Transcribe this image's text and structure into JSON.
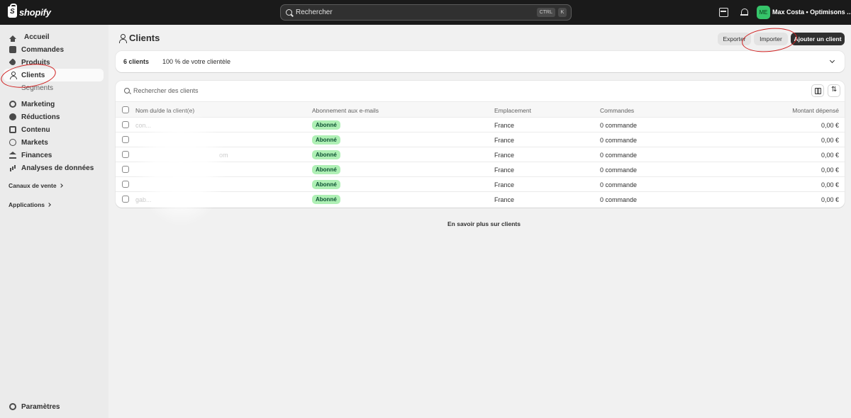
{
  "topbar": {
    "logo_text": "shopify",
    "search_placeholder": "Rechercher",
    "shortcut_ctrl": "CTRL",
    "shortcut_k": "K",
    "avatar_initials": "ME",
    "store_name": "Max Costa • Optimisons ..."
  },
  "sidebar": {
    "items": [
      {
        "label": "Accueil",
        "icon": "home-icon"
      },
      {
        "label": "Commandes",
        "icon": "inbox-icon"
      },
      {
        "label": "Produits",
        "icon": "tag-icon"
      },
      {
        "label": "Clients",
        "icon": "person-icon",
        "active": true
      },
      {
        "label": "Segments",
        "sub": true
      },
      {
        "label": "Marketing",
        "icon": "target-icon"
      },
      {
        "label": "Réductions",
        "icon": "discount-icon"
      },
      {
        "label": "Contenu",
        "icon": "content-icon"
      },
      {
        "label": "Markets",
        "icon": "globe-icon"
      },
      {
        "label": "Finances",
        "icon": "bank-icon"
      },
      {
        "label": "Analyses de données",
        "icon": "chart-icon"
      }
    ],
    "sales_channels": "Canaux de vente",
    "applications": "Applications",
    "settings": "Paramètres"
  },
  "page": {
    "title": "Clients",
    "export_label": "Exporter",
    "import_label": "Importer",
    "add_label": "Ajouter un client"
  },
  "stats": {
    "count": "6 clients",
    "percent": "100 % de votre clientèle"
  },
  "table": {
    "search_placeholder": "Rechercher des clients",
    "headers": {
      "name": "Nom du/de la client(e)",
      "subscription": "Abonnement aux e-mails",
      "location": "Emplacement",
      "orders": "Commandes",
      "spent": "Montant dépensé"
    },
    "rows": [
      {
        "name": "con...",
        "subscription": "Abonné",
        "location": "France",
        "orders": "0 commande",
        "spent": "0,00 €"
      },
      {
        "name": "",
        "subscription": "Abonné",
        "location": "France",
        "orders": "0 commande",
        "spent": "0,00 €"
      },
      {
        "name": "om",
        "subscription": "Abonné",
        "location": "France",
        "orders": "0 commande",
        "spent": "0,00 €"
      },
      {
        "name": "",
        "subscription": "Abonné",
        "location": "France",
        "orders": "0 commande",
        "spent": "0,00 €"
      },
      {
        "name": "",
        "subscription": "Abonné",
        "location": "France",
        "orders": "0 commande",
        "spent": "0,00 €"
      },
      {
        "name": "gab...",
        "subscription": "Abonné",
        "location": "France",
        "orders": "0 commande",
        "spent": "0,00 €"
      }
    ]
  },
  "footer": {
    "learn_more": "En savoir plus sur clients"
  },
  "colors": {
    "topbar": "#1a1a1a",
    "badge_bg": "#aff0b5",
    "badge_text": "#0c5132",
    "annotation": "#d01e1e",
    "avatar": "#36c46a"
  }
}
